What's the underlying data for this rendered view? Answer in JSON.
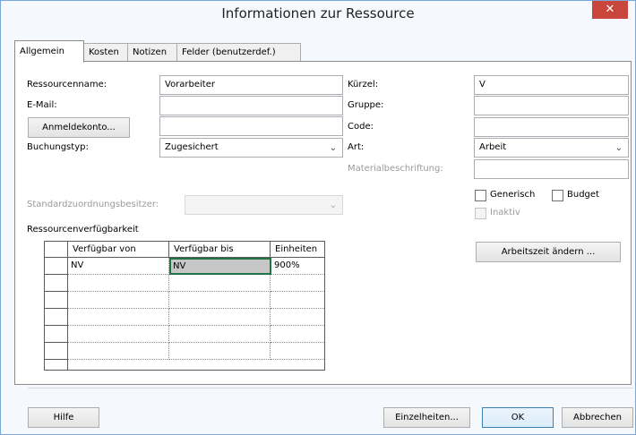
{
  "window": {
    "title": "Informationen zur Ressource",
    "close_icon": "✕"
  },
  "tabs": [
    {
      "label": "Allgemein",
      "active": true
    },
    {
      "label": "Kosten",
      "active": false
    },
    {
      "label": "Notizen",
      "active": false
    },
    {
      "label": "Felder (benutzerdef.)",
      "active": false
    }
  ],
  "left": {
    "resource_name_label": "Ressourcenname:",
    "resource_name_value": "Vorarbeiter",
    "email_label": "E-Mail:",
    "email_value": "",
    "login_button": "Anmeldekonto...",
    "login_value": "",
    "booking_label": "Buchungstyp:",
    "booking_value": "Zugesichert",
    "default_owner_label": "Standardzuordnungsbesitzer:",
    "default_owner_value": ""
  },
  "right": {
    "initials_label": "Kürzel:",
    "initials_value": "V",
    "group_label": "Gruppe:",
    "group_value": "",
    "code_label": "Code:",
    "code_value": "",
    "type_label": "Art:",
    "type_value": "Arbeit",
    "material_label": "Materialbeschriftung:",
    "material_value": "",
    "generic_label": "Generisch",
    "budget_label": "Budget",
    "inactive_label": "Inaktiv",
    "change_worktime_button": "Arbeitszeit ändern ..."
  },
  "availability": {
    "title": "Ressourcenverfügbarkeit",
    "columns": [
      "Verfügbar von",
      "Verfügbar bis",
      "Einheiten"
    ],
    "rows": [
      [
        "NV",
        "NV",
        "900%"
      ],
      [
        "",
        "",
        ""
      ],
      [
        "",
        "",
        ""
      ],
      [
        "",
        "",
        ""
      ],
      [
        "",
        "",
        ""
      ],
      [
        "",
        "",
        ""
      ]
    ]
  },
  "footer": {
    "help_button": "Hilfe",
    "details_button": "Einzelheiten...",
    "ok_button": "OK",
    "cancel_button": "Abbrechen"
  },
  "icons": {
    "chevron_down": "⌄",
    "scroll_up": "^",
    "scroll_down": "v"
  },
  "colors": {
    "accent": "#217346",
    "close": "#c9463d",
    "window_border": "#7aa6dc"
  }
}
